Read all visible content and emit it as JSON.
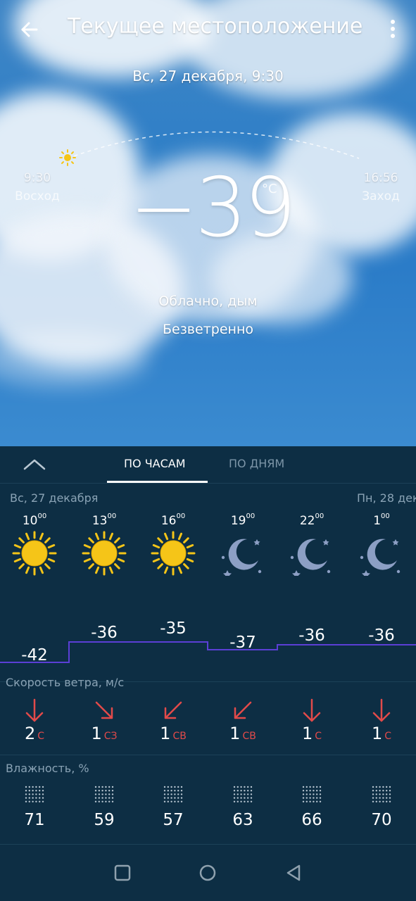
{
  "header": {
    "title": "Текущее местоположение"
  },
  "current": {
    "date_time": "Вс, 27 декабря, 9:30",
    "sunrise_time": "9:30",
    "sunrise_label": "Восход",
    "sunset_time": "16:56",
    "sunset_label": "Заход",
    "temperature": "−39",
    "unit": "°C",
    "condition": "Облачно, дым",
    "wind": "Безветренно"
  },
  "tabs": {
    "hourly": "ПО ЧАСАМ",
    "daily": "ПО ДНЯМ"
  },
  "days": {
    "today": "Вс, 27 декабря",
    "tomorrow": "Пн, 28 дек"
  },
  "sections": {
    "wind": "Скорость ветра, м/с",
    "humidity": "Влажность, %"
  },
  "hourly": [
    {
      "hour": "10",
      "min": "00",
      "icon": "sun-icon",
      "temp": "-42",
      "wind_speed": "2",
      "wind_dir": "С",
      "humidity": "71"
    },
    {
      "hour": "13",
      "min": "00",
      "icon": "sun-icon",
      "temp": "-36",
      "wind_speed": "1",
      "wind_dir": "СЗ",
      "humidity": "59"
    },
    {
      "hour": "16",
      "min": "00",
      "icon": "sun-icon",
      "temp": "-35",
      "wind_speed": "1",
      "wind_dir": "СВ",
      "humidity": "57"
    },
    {
      "hour": "19",
      "min": "00",
      "icon": "moon-icon",
      "temp": "-37",
      "wind_speed": "1",
      "wind_dir": "СВ",
      "humidity": "63"
    },
    {
      "hour": "22",
      "min": "00",
      "icon": "moon-icon",
      "temp": "-36",
      "wind_speed": "1",
      "wind_dir": "С",
      "humidity": "66"
    },
    {
      "hour": "1",
      "min": "00",
      "icon": "moon-icon",
      "temp": "-36",
      "wind_speed": "1",
      "wind_dir": "С",
      "humidity": "70"
    }
  ],
  "colors": {
    "panel": "#0d2e44",
    "sun": "#f5c518",
    "moon": "#8c9fc4",
    "wind_arrow": "#e24a4a",
    "temp_line": "#5b3fd6"
  }
}
